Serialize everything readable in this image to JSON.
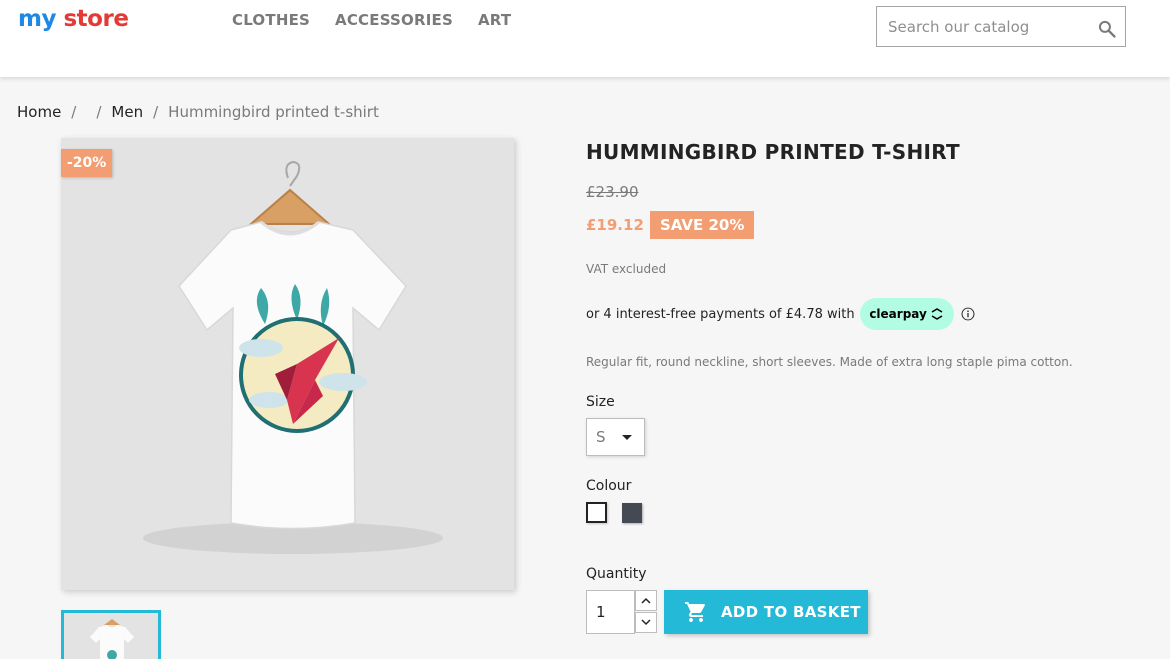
{
  "header": {
    "logo_part1": "my",
    "logo_part2": "store",
    "nav": [
      "CLOTHES",
      "ACCESSORIES",
      "ART"
    ],
    "search_placeholder": "Search our catalog"
  },
  "breadcrumb": {
    "home": "Home",
    "sep": "/",
    "men": "Men",
    "current": "Hummingbird printed t-shirt"
  },
  "product": {
    "discount_badge": "-20%",
    "title": "HUMMINGBIRD PRINTED T-SHIRT",
    "old_price": "£23.90",
    "price": "£19.12",
    "save_label": "SAVE 20%",
    "vat": "VAT excluded",
    "clearpay_text": "or 4 interest-free payments of £4.78 with",
    "clearpay_brand": "clearpay",
    "description": "Regular fit, round neckline, short sleeves. Made of extra long staple pima cotton.",
    "size_label": "Size",
    "size_value": "S",
    "colour_label": "Colour",
    "colours": [
      "#ffffff",
      "#434a54"
    ],
    "quantity_label": "Quantity",
    "quantity_value": "1",
    "add_to_basket": "ADD TO BASKET"
  },
  "colors": {
    "accent": "#24b9d7",
    "discount": "#f39d72",
    "clearpay": "#b2fce4"
  },
  "icons": [
    "search-icon",
    "info-icon",
    "caret-down-icon",
    "chevron-up-icon",
    "chevron-down-icon",
    "cart-icon"
  ]
}
